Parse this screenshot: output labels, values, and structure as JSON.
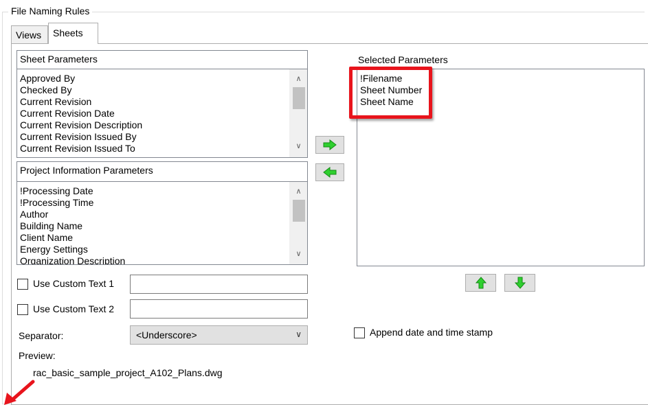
{
  "group_title": "File Naming Rules",
  "tabs": [
    {
      "label": "Views"
    },
    {
      "label": "Sheets"
    }
  ],
  "sheet_parameters": {
    "header": "Sheet Parameters",
    "items": [
      "Approved By",
      "Checked By",
      "Current Revision",
      "Current Revision Date",
      "Current Revision Description",
      "Current Revision Issued By",
      "Current Revision Issued To"
    ]
  },
  "project_parameters": {
    "header": "Project Information Parameters",
    "items": [
      "!Processing Date",
      "!Processing Time",
      "Author",
      "Building Name",
      "Client Name",
      "Energy Settings",
      "Organization Description"
    ]
  },
  "selected_parameters": {
    "label": "Selected Parameters",
    "items": [
      "!Filename",
      "Sheet Number",
      "Sheet Name"
    ]
  },
  "custom_text_1": {
    "label": "Use Custom Text 1",
    "value": ""
  },
  "custom_text_2": {
    "label": "Use Custom Text 2",
    "value": ""
  },
  "separator": {
    "label": "Separator:",
    "value": "<Underscore>"
  },
  "append_stamp": {
    "label": "Append date and time stamp"
  },
  "preview": {
    "label": "Preview:",
    "value": "rac_basic_sample_project_A102_Plans.dwg"
  },
  "colors": {
    "highlight_red": "#e8141c",
    "arrow_green": "#19b519"
  },
  "icons": {
    "add": "arrow-right-icon",
    "remove": "arrow-left-icon",
    "up": "arrow-up-icon",
    "down": "arrow-down-icon"
  }
}
